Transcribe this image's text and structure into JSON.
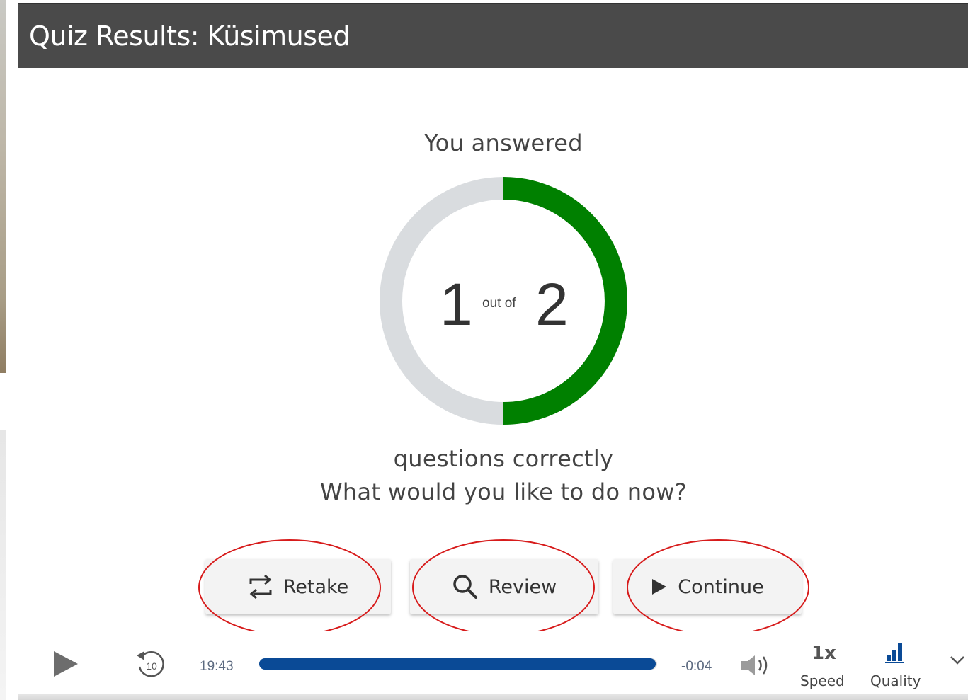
{
  "header": {
    "title": "Quiz Results: Küsimused"
  },
  "results": {
    "intro": "You answered",
    "correct": "1",
    "out_of_label": "out of",
    "total": "2",
    "score_fraction": 0.5,
    "suffix": "questions correctly",
    "prompt": "What would you like to do now?"
  },
  "colors": {
    "ring_fill": "#008000",
    "ring_track": "#d9dcdf",
    "annotation": "#d71b1b",
    "progress": "#0a4a96"
  },
  "actions": {
    "retake": {
      "label": "Retake",
      "icon": "retake-icon"
    },
    "review": {
      "label": "Review",
      "icon": "search-icon"
    },
    "continue": {
      "label": "Continue",
      "icon": "play-icon"
    }
  },
  "player": {
    "elapsed": "19:43",
    "remaining": "-0:04",
    "progress": 0.997,
    "rewind_seconds": "10",
    "speed_value": "1x",
    "speed_label": "Speed",
    "quality_label": "Quality"
  }
}
